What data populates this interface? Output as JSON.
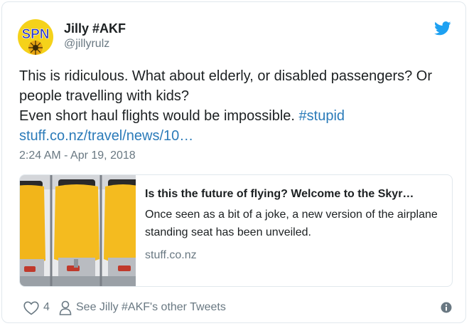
{
  "author": {
    "name": "Jilly #AKF",
    "handle": "@jillyrulz",
    "avatar_text": "SPN"
  },
  "tweet": {
    "line1": "This is ridiculous. What about elderly, or disabled passengers? Or",
    "line2": "people travelling with kids?",
    "line3_text": "Even short haul flights would be impossible. ",
    "hashtag": "#stupid",
    "url": "stuff.co.nz/travel/news/10…"
  },
  "timestamp": "2:24 AM - Apr 19, 2018",
  "link_card": {
    "title": "Is this the future of flying? Welcome to the Skyr…",
    "description": "Once seen as a bit of a joke, a new version of the airplane standing seat has been unveiled.",
    "domain": "stuff.co.nz"
  },
  "footer": {
    "likes": "4",
    "other_tweets": "See Jilly #AKF's other Tweets"
  },
  "icons": {
    "brand": "twitter-bird-icon",
    "like": "heart-icon",
    "profile": "person-icon",
    "info": "info-icon"
  },
  "colors": {
    "link": "#2b7bb9",
    "twitter_blue": "#1da1f2",
    "muted": "#697882",
    "border": "#e1e8ed"
  }
}
